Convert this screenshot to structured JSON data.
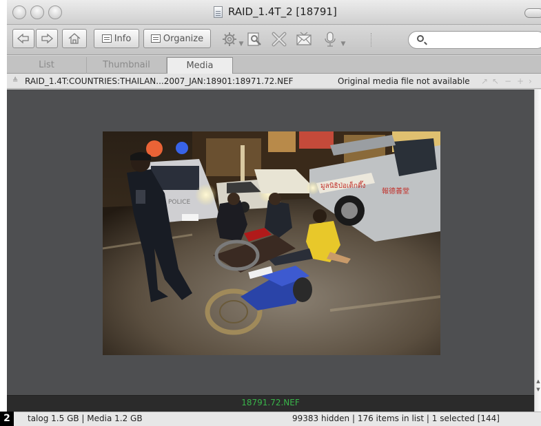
{
  "window": {
    "title": "RAID_1.4T_2 [18791]"
  },
  "toolbar": {
    "info_label": "Info",
    "organize_label": "Organize",
    "search_placeholder": ""
  },
  "tabs": [
    {
      "label": "List",
      "active": false
    },
    {
      "label": "Thumbnail",
      "active": false
    },
    {
      "label": "Media",
      "active": true
    }
  ],
  "pathbar": {
    "path": "RAID_1.4T:COUNTRIES:THAILAN...2007_JAN:18901:18971.72.NEF",
    "status": "Original media file not available"
  },
  "viewer": {
    "filename": "18791.72.NEF",
    "photo_signs": {
      "truck_door": "มูลนิธิป่อเต็กตึ๊ง",
      "truck_cn": "報德善堂",
      "van": "POLICE"
    }
  },
  "statusbar": {
    "badge": "2",
    "left": "talog  1.5 GB   |  Media 1.2 GB",
    "right": "99383 hidden   |   176 items in list   |  1 selected [144]"
  },
  "colors": {
    "viewer_bg": "#4e4f51",
    "filename_color": "#39b54a"
  }
}
